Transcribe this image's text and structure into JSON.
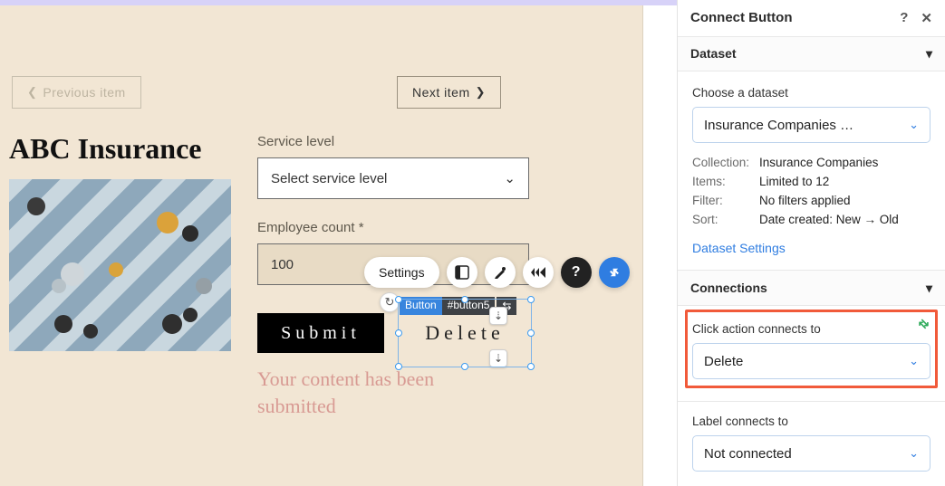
{
  "nav": {
    "prev_label": "Previous item",
    "next_label": "Next item"
  },
  "headline": "ABC Insurance",
  "form": {
    "service_label": "Service level",
    "service_placeholder": "Select service level",
    "employee_label": "Employee count *",
    "employee_value": "100",
    "submit_label": "Submit",
    "delete_label": "Delete",
    "success_msg": "Your content has been submitted"
  },
  "selection": {
    "type_tag": "Button",
    "id_tag": "#button5"
  },
  "toolbar": {
    "settings_label": "Settings"
  },
  "panel": {
    "title": "Connect Button",
    "dataset_header": "Dataset",
    "choose_label": "Choose a dataset",
    "dataset_selected": "Insurance Companies …",
    "meta": {
      "collection_k": "Collection:",
      "collection_v": "Insurance Companies",
      "items_k": "Items:",
      "items_v": "Limited to 12",
      "filter_k": "Filter:",
      "filter_v": "No filters applied",
      "sort_k": "Sort:",
      "sort_v": "Date created: New → Old"
    },
    "settings_link": "Dataset Settings",
    "connections_header": "Connections",
    "click_label": "Click action connects to",
    "click_value": "Delete",
    "label_label": "Label connects to",
    "label_value": "Not connected"
  }
}
